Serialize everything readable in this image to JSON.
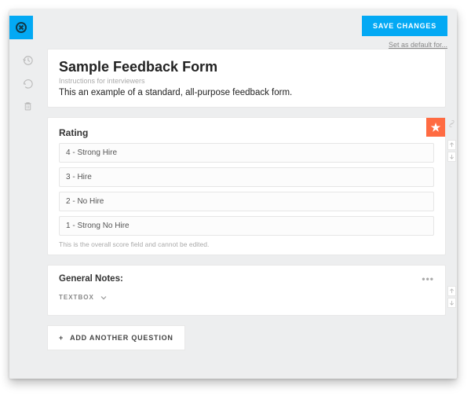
{
  "actions": {
    "save": "SAVE CHANGES",
    "set_default": "Set as default for..."
  },
  "header": {
    "title": "Sample Feedback Form",
    "instructions_label": "Instructions for interviewers",
    "description": "This an example of a standard, all-purpose feedback form."
  },
  "rating": {
    "title": "Rating",
    "options": [
      "4 - Strong Hire",
      "3 - Hire",
      "2 - No Hire",
      "1 - Strong No Hire"
    ],
    "locked_note": "This is the overall score field and cannot be edited."
  },
  "notes": {
    "title": "General Notes:",
    "field_type": "TEXTBOX"
  },
  "add_question": "ADD ANOTHER QUESTION"
}
